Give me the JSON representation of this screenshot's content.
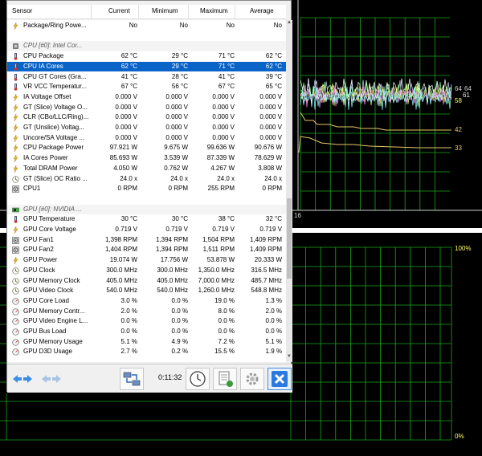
{
  "table": {
    "headers": {
      "sensor": "Sensor",
      "current": "Current",
      "minimum": "Minimum",
      "maximum": "Maximum",
      "average": "Average"
    },
    "rows": [
      {
        "type": "item",
        "name": "Package/Ring Powe...",
        "current": "No",
        "minimum": "No",
        "maximum": "No",
        "average": "No",
        "icon": "bolt-icon"
      },
      {
        "type": "spacer"
      },
      {
        "type": "group",
        "name": "CPU [#0]: Intel Cor...",
        "icon": "cpu-chip-icon"
      },
      {
        "type": "item",
        "name": "CPU Package",
        "current": "62 °C",
        "minimum": "29 °C",
        "maximum": "71 °C",
        "average": "62 °C",
        "icon": "thermometer-icon"
      },
      {
        "type": "item",
        "name": "CPU IA Cores",
        "current": "62 °C",
        "minimum": "29 °C",
        "maximum": "71 °C",
        "average": "62 °C",
        "icon": "thermometer-icon",
        "selected": true
      },
      {
        "type": "item",
        "name": "CPU GT Cores (Gra...",
        "current": "41 °C",
        "minimum": "28 °C",
        "maximum": "41 °C",
        "average": "39 °C",
        "icon": "thermometer-icon"
      },
      {
        "type": "item",
        "name": "VR VCC Temperatur...",
        "current": "67 °C",
        "minimum": "56 °C",
        "maximum": "67 °C",
        "average": "65 °C",
        "icon": "thermometer-icon"
      },
      {
        "type": "item",
        "name": "IA Voltage Offset",
        "current": "0.000 V",
        "minimum": "0.000 V",
        "maximum": "0.000 V",
        "average": "0.000 V",
        "icon": "bolt-icon"
      },
      {
        "type": "item",
        "name": "GT (Slice) Voltage O...",
        "current": "0.000 V",
        "minimum": "0.000 V",
        "maximum": "0.000 V",
        "average": "0.000 V",
        "icon": "bolt-icon"
      },
      {
        "type": "item",
        "name": "CLR (CBo/LLC/Ring)...",
        "current": "0.000 V",
        "minimum": "0.000 V",
        "maximum": "0.000 V",
        "average": "0.000 V",
        "icon": "bolt-icon"
      },
      {
        "type": "item",
        "name": "GT (Unslice) Voltag...",
        "current": "0.000 V",
        "minimum": "0.000 V",
        "maximum": "0.000 V",
        "average": "0.000 V",
        "icon": "bolt-icon"
      },
      {
        "type": "item",
        "name": "Uncore/SA Voltage ...",
        "current": "0.000 V",
        "minimum": "0.000 V",
        "maximum": "0.000 V",
        "average": "0.000 V",
        "icon": "bolt-icon"
      },
      {
        "type": "item",
        "name": "CPU Package Power",
        "current": "97.921 W",
        "minimum": "9.675 W",
        "maximum": "99.636 W",
        "average": "90.676 W",
        "icon": "bolt-icon"
      },
      {
        "type": "item",
        "name": "IA Cores Power",
        "current": "85.693 W",
        "minimum": "3.539 W",
        "maximum": "87.339 W",
        "average": "78.629 W",
        "icon": "bolt-icon"
      },
      {
        "type": "item",
        "name": "Total DRAM Power",
        "current": "4.050 W",
        "minimum": "0.762 W",
        "maximum": "4.267 W",
        "average": "3.808 W",
        "icon": "bolt-icon"
      },
      {
        "type": "item",
        "name": "GT (Slice) OC Ratio ...",
        "current": "24.0 x",
        "minimum": "24.0 x",
        "maximum": "24.0 x",
        "average": "24.0 x",
        "icon": "clock-icon"
      },
      {
        "type": "item",
        "name": "CPU1",
        "current": "0 RPM",
        "minimum": "0 RPM",
        "maximum": "255 RPM",
        "average": "0 RPM",
        "icon": "fan-icon"
      },
      {
        "type": "spacer"
      },
      {
        "type": "group",
        "name": "GPU [#0]: NVIDIA ...",
        "icon": "gpu-chip-icon"
      },
      {
        "type": "item",
        "name": "GPU Temperature",
        "current": "30 °C",
        "minimum": "30 °C",
        "maximum": "38 °C",
        "average": "32 °C",
        "icon": "thermometer-icon"
      },
      {
        "type": "item",
        "name": "GPU Core Voltage",
        "current": "0.719 V",
        "minimum": "0.719 V",
        "maximum": "0.719 V",
        "average": "0.719 V",
        "icon": "bolt-icon"
      },
      {
        "type": "item",
        "name": "GPU Fan1",
        "current": "1,398 RPM",
        "minimum": "1,394 RPM",
        "maximum": "1,504 RPM",
        "average": "1,409 RPM",
        "icon": "fan-icon"
      },
      {
        "type": "item",
        "name": "GPU Fan2",
        "current": "1,404 RPM",
        "minimum": "1,394 RPM",
        "maximum": "1,511 RPM",
        "average": "1,409 RPM",
        "icon": "fan-icon"
      },
      {
        "type": "item",
        "name": "GPU Power",
        "current": "19.074 W",
        "minimum": "17.756 W",
        "maximum": "53.878 W",
        "average": "20.333 W",
        "icon": "bolt-icon"
      },
      {
        "type": "item",
        "name": "GPU Clock",
        "current": "300.0 MHz",
        "minimum": "300.0 MHz",
        "maximum": "1,350.0 MHz",
        "average": "316.5 MHz",
        "icon": "clock-icon"
      },
      {
        "type": "item",
        "name": "GPU Memory Clock",
        "current": "405.0 MHz",
        "minimum": "405.0 MHz",
        "maximum": "7,000.0 MHz",
        "average": "485.7 MHz",
        "icon": "clock-icon"
      },
      {
        "type": "item",
        "name": "GPU Video Clock",
        "current": "540.0 MHz",
        "minimum": "540.0 MHz",
        "maximum": "1,260.0 MHz",
        "average": "548.8 MHz",
        "icon": "clock-icon"
      },
      {
        "type": "item",
        "name": "GPU Core Load",
        "current": "3.0 %",
        "minimum": "0.0 %",
        "maximum": "19.0 %",
        "average": "1.3 %",
        "icon": "gauge-icon"
      },
      {
        "type": "item",
        "name": "GPU Memory Contr...",
        "current": "2.0 %",
        "minimum": "0.0 %",
        "maximum": "8.0 %",
        "average": "2.0 %",
        "icon": "gauge-icon"
      },
      {
        "type": "item",
        "name": "GPU Video Engine L...",
        "current": "0.0 %",
        "minimum": "0.0 %",
        "maximum": "0.0 %",
        "average": "0.0 %",
        "icon": "gauge-icon"
      },
      {
        "type": "item",
        "name": "GPU Bus Load",
        "current": "0.0 %",
        "minimum": "0.0 %",
        "maximum": "0.0 %",
        "average": "0.0 %",
        "icon": "gauge-icon"
      },
      {
        "type": "item",
        "name": "GPU Memory Usage",
        "current": "5.1 %",
        "minimum": "4.9 %",
        "maximum": "7.2 %",
        "average": "5.1 %",
        "icon": "gauge-icon"
      },
      {
        "type": "item",
        "name": "GPU D3D Usage",
        "current": "2.7 %",
        "minimum": "0.2 %",
        "maximum": "15.5 %",
        "average": "1.9 %",
        "icon": "gauge-icon"
      }
    ]
  },
  "toolbar": {
    "timer": "0:11:32",
    "icons": [
      "nav-arrows-icon",
      "nav-arrows-disabled-icon",
      "network-icon",
      "clock-icon",
      "add-sheet-icon",
      "settings-icon",
      "close-icon"
    ]
  },
  "graphs": {
    "top_labels": [
      "64",
      "64",
      "61",
      "58",
      "42",
      "33",
      "16"
    ],
    "bottom_labels": [
      "100%",
      "0%"
    ],
    "colors": {
      "grid": "#1aa51a",
      "label": "#ffff66",
      "selected": "#0a64c8"
    }
  }
}
